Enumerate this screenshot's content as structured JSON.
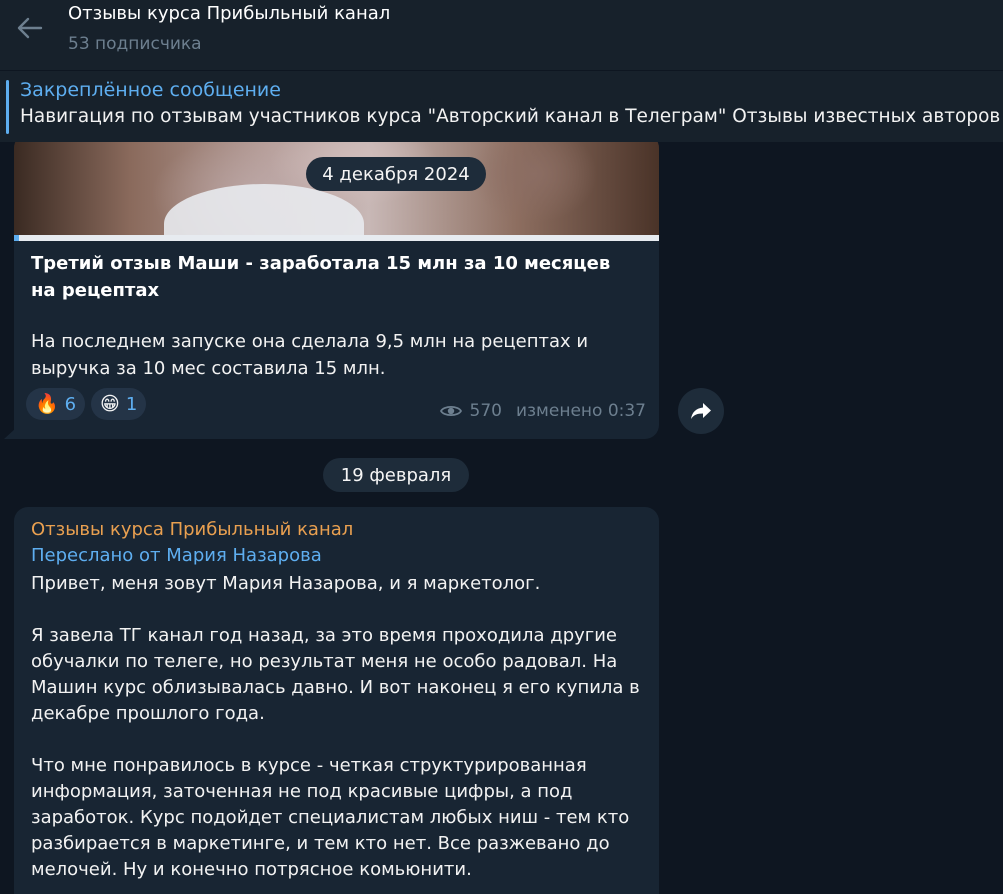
{
  "header": {
    "title": "Отзывы курса Прибыльный канал",
    "subtitle": "53 подписчика"
  },
  "pinned": {
    "title": "Закреплённое сообщение",
    "text": "Навигация по отзывам участников курса \"Авторский канал в Телеграм\"  Отзывы известных авторов боль"
  },
  "message1": {
    "date_label": "4 декабря 2024",
    "title": "Третий отзыв Маши - заработала 15 млн за 10 месяцев на рецептах",
    "body": "На последнем запуске она сделала 9,5 млн на рецептах и выручка за 10 мес составила 15 млн.",
    "reactions": [
      {
        "emoji": "🔥",
        "count": "6"
      },
      {
        "emoji": "😁",
        "count": "1"
      }
    ],
    "views": "570",
    "edited": "изменено 0:37"
  },
  "date_separator": "19 февраля",
  "message2": {
    "sender": "Отзывы курса Прибыльный канал",
    "forwarded_from": "Переслано от Мария Назарова",
    "paragraphs": [
      "Привет, меня зовут Мария Назарова, и я маркетолог.",
      "Я завела ТГ канал год назад, за это время проходила другие обучалки по телеге, но результат меня не особо радовал. На Машин курс облизывалась давно. И вот наконец я его купила в декабре прошлого года.",
      "Что мне понравилось в курсе - четкая структурированная информация, заточенная не под красивые цифры, а под заработок. Курс подойдет специалистам любых ниш - тем кто разбирается в маркетинге, и тем кто нет. Все разжевано до мелочей. Ну и конечно потрясное комьюнити."
    ]
  },
  "colors": {
    "background": "#0e1621",
    "panel": "#17212b",
    "bubble": "#182533",
    "accent": "#5eaef0",
    "sender": "#e9a050",
    "muted": "#6d7f8f"
  },
  "icons": {
    "back": "arrow-left-icon",
    "views": "eye-icon",
    "share": "share-arrow-icon"
  }
}
